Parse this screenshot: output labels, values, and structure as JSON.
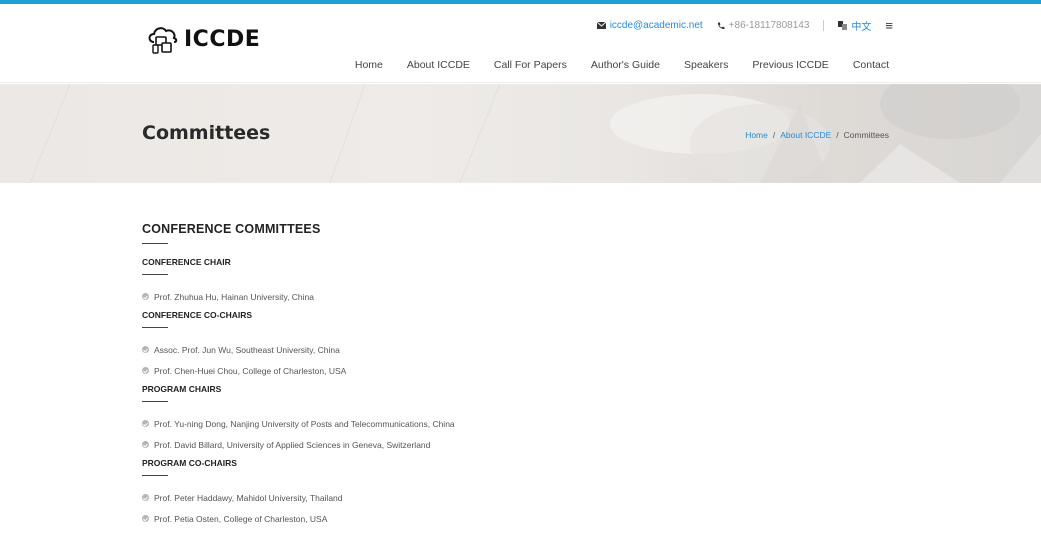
{
  "header": {
    "logo_text": "ICCDE",
    "email": "iccde@academic.net",
    "phone": "+86-18117808143",
    "language": "中文",
    "menu_icon": "≡"
  },
  "nav": [
    "Home",
    "About ICCDE",
    "Call For Papers",
    "Author's Guide",
    "Speakers",
    "Previous ICCDE",
    "Contact"
  ],
  "banner": {
    "title": "Committees",
    "breadcrumb": {
      "home": "Home",
      "about": "About ICCDE",
      "current": "Committees",
      "separator": "/"
    }
  },
  "main": {
    "heading": "CONFERENCE COMMITTEES",
    "sections": [
      {
        "title": "CONFERENCE CHAIR",
        "members": [
          "Prof. Zhuhua Hu, Hainan University, China"
        ]
      },
      {
        "title": "CONFERENCE CO-CHAIRS",
        "members": [
          "Assoc. Prof. Jun Wu, Southeast University, China",
          "Prof. Chen-Huei Chou, College of Charleston, USA"
        ]
      },
      {
        "title": "PROGRAM CHAIRS",
        "members": [
          "Prof. Yu-ning Dong, Nanjing University of Posts and Telecommunications, China",
          "Prof. David Billard, University of Applied Sciences in Geneva, Switzerland"
        ]
      },
      {
        "title": "PROGRAM CO-CHAIRS",
        "members": [
          "Prof. Peter Haddawy, Mahidol University, Thailand",
          "Prof. Petia Osten, College of Charleston, USA"
        ]
      }
    ]
  },
  "colors": {
    "accent": "#1e9fd8",
    "link": "#2a8bd0"
  }
}
